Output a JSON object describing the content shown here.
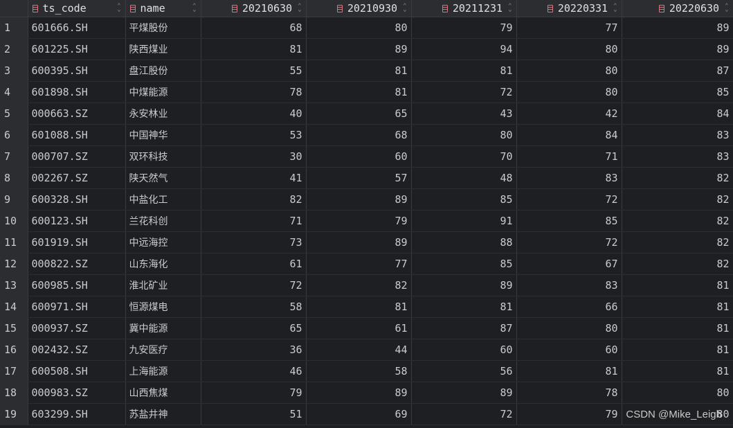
{
  "columns": [
    {
      "label": "",
      "kind": "rownum"
    },
    {
      "label": "ts_code",
      "kind": "text"
    },
    {
      "label": "name",
      "kind": "text"
    },
    {
      "label": "20210630",
      "kind": "num"
    },
    {
      "label": "20210930",
      "kind": "num"
    },
    {
      "label": "20211231",
      "kind": "num"
    },
    {
      "label": "20220331",
      "kind": "num"
    },
    {
      "label": "20220630",
      "kind": "num"
    }
  ],
  "icons": {
    "column_icon": "column-table-icon",
    "sort_icon": "sort-toggle-icon",
    "sort_glyph": "⌃⌄"
  },
  "colors": {
    "column_icon": "#d9747f",
    "background": "#1e1f22",
    "header": "#2b2d30"
  },
  "rows": [
    [
      "1",
      "601666.SH",
      "平煤股份",
      "68",
      "80",
      "79",
      "77",
      "89"
    ],
    [
      "2",
      "601225.SH",
      "陕西煤业",
      "81",
      "89",
      "94",
      "80",
      "89"
    ],
    [
      "3",
      "600395.SH",
      "盘江股份",
      "55",
      "81",
      "81",
      "80",
      "87"
    ],
    [
      "4",
      "601898.SH",
      "中煤能源",
      "78",
      "81",
      "72",
      "80",
      "85"
    ],
    [
      "5",
      "000663.SZ",
      "永安林业",
      "40",
      "65",
      "43",
      "42",
      "84"
    ],
    [
      "6",
      "601088.SH",
      "中国神华",
      "53",
      "68",
      "80",
      "84",
      "83"
    ],
    [
      "7",
      "000707.SZ",
      "双环科技",
      "30",
      "60",
      "70",
      "71",
      "83"
    ],
    [
      "8",
      "002267.SZ",
      "陕天然气",
      "41",
      "57",
      "48",
      "83",
      "82"
    ],
    [
      "9",
      "600328.SH",
      "中盐化工",
      "82",
      "89",
      "85",
      "72",
      "82"
    ],
    [
      "10",
      "600123.SH",
      "兰花科创",
      "71",
      "79",
      "91",
      "85",
      "82"
    ],
    [
      "11",
      "601919.SH",
      "中远海控",
      "73",
      "89",
      "88",
      "72",
      "82"
    ],
    [
      "12",
      "000822.SZ",
      "山东海化",
      "61",
      "77",
      "85",
      "67",
      "82"
    ],
    [
      "13",
      "600985.SH",
      "淮北矿业",
      "72",
      "82",
      "89",
      "83",
      "81"
    ],
    [
      "14",
      "600971.SH",
      "恒源煤电",
      "58",
      "81",
      "81",
      "66",
      "81"
    ],
    [
      "15",
      "000937.SZ",
      "冀中能源",
      "65",
      "61",
      "87",
      "80",
      "81"
    ],
    [
      "16",
      "002432.SZ",
      "九安医疗",
      "36",
      "44",
      "60",
      "60",
      "81"
    ],
    [
      "17",
      "600508.SH",
      "上海能源",
      "46",
      "58",
      "56",
      "81",
      "81"
    ],
    [
      "18",
      "000983.SZ",
      "山西焦煤",
      "79",
      "89",
      "89",
      "78",
      "80"
    ],
    [
      "19",
      "603299.SH",
      "苏盐井神",
      "51",
      "69",
      "72",
      "79",
      "80"
    ]
  ],
  "watermark": "CSDN @Mike_Leigh"
}
